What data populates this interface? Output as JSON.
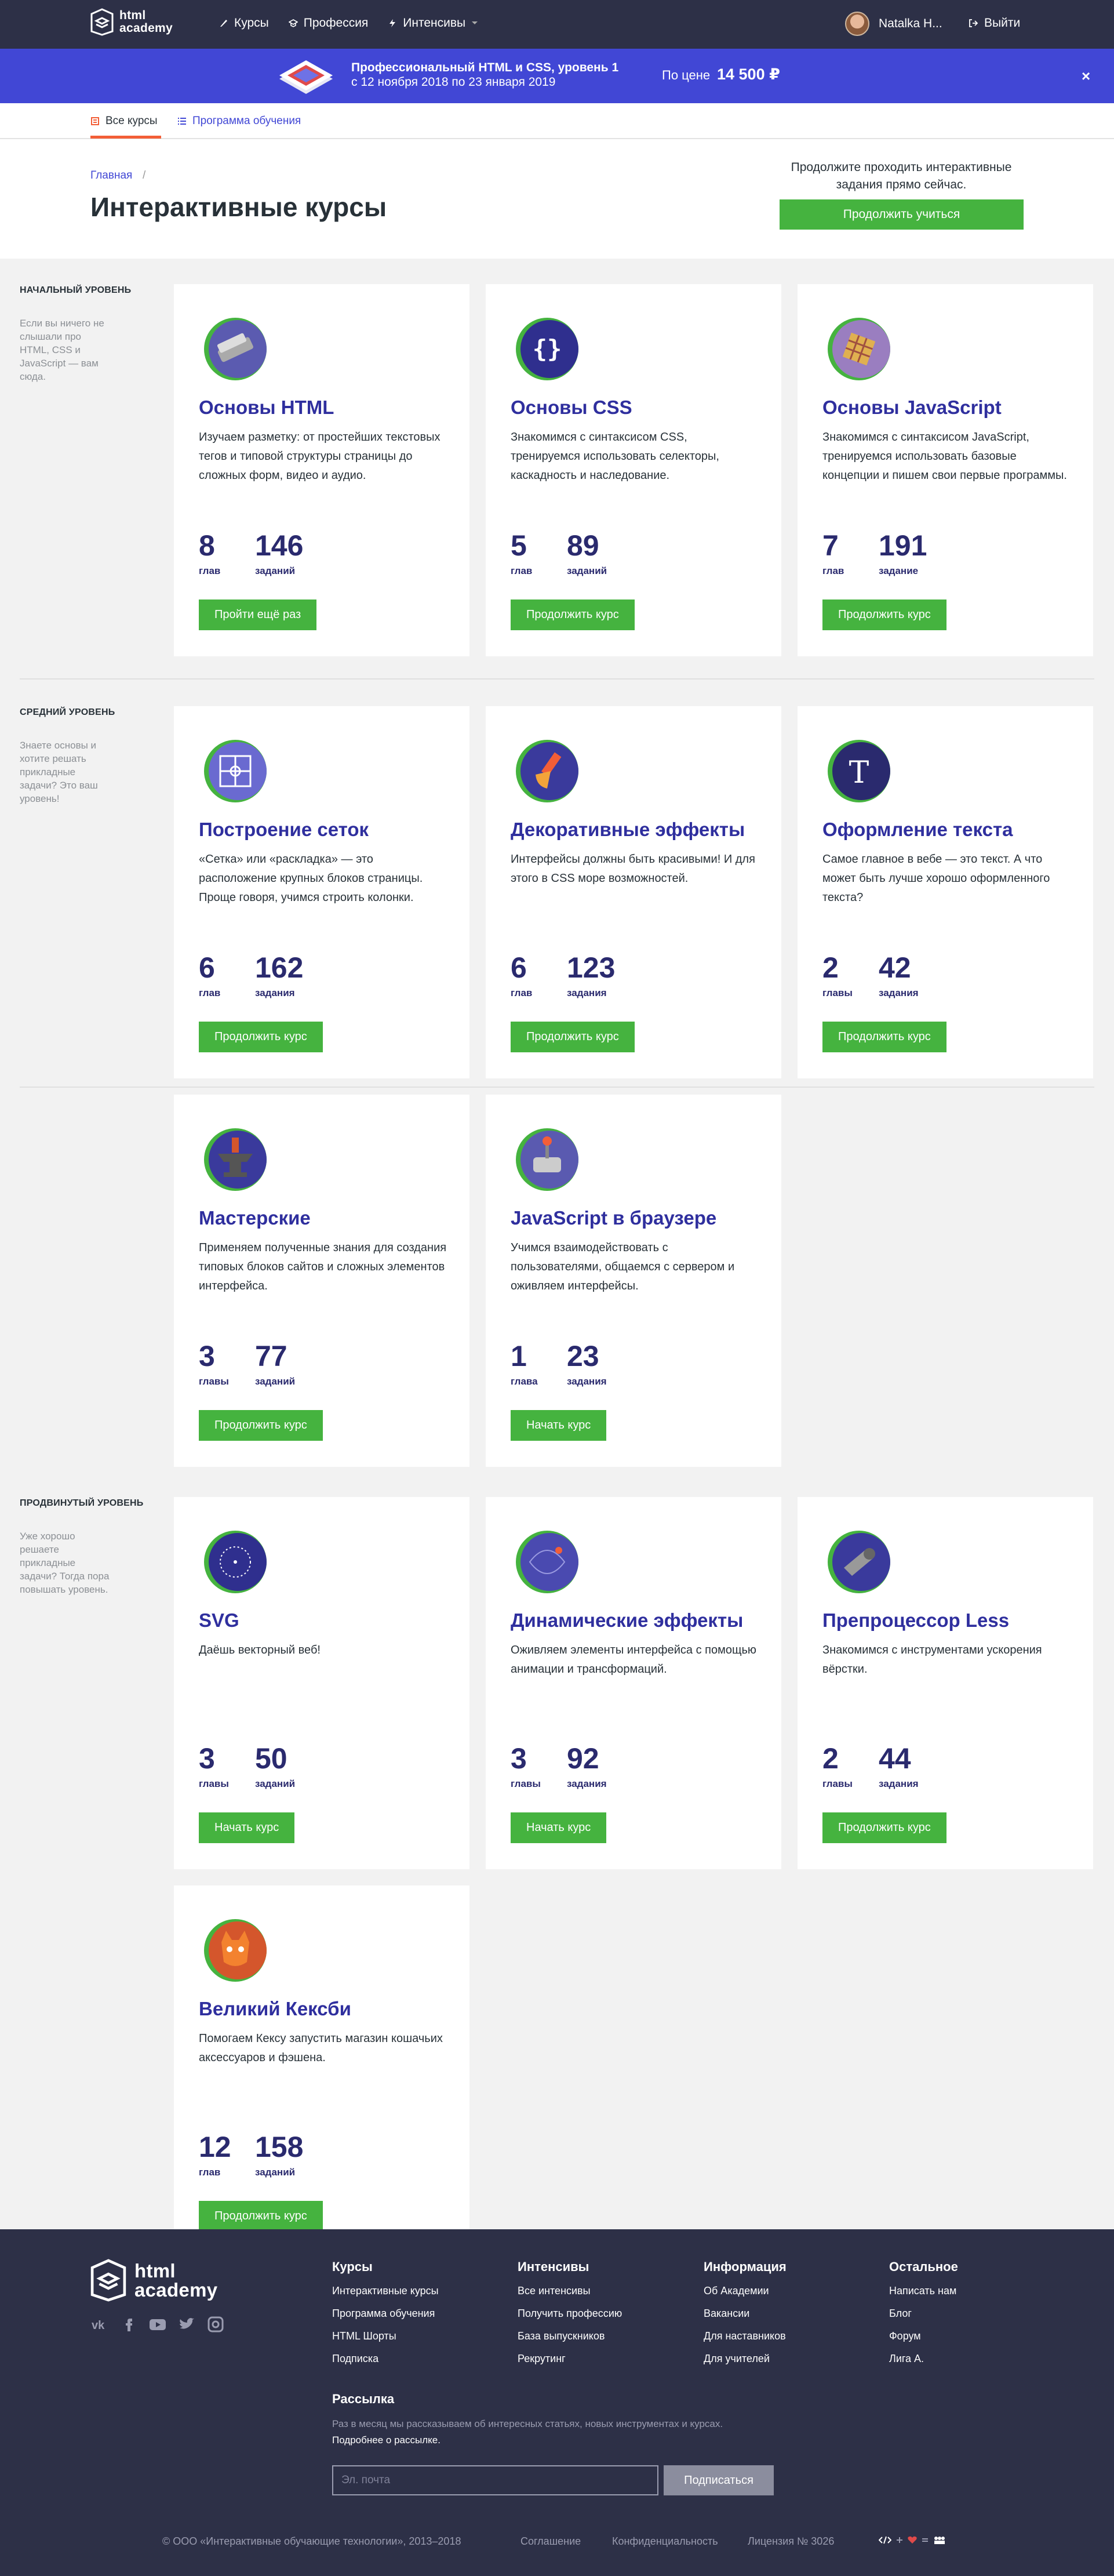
{
  "header": {
    "logo_text_1": "html",
    "logo_text_2": "academy",
    "nav": [
      {
        "label": "Курсы",
        "icon": "courses-icon"
      },
      {
        "label": "Профессия",
        "icon": "profession-icon"
      },
      {
        "label": "Интенсивы",
        "icon": "lightning-icon"
      }
    ],
    "user_name": "Natalka H...",
    "logout_label": "Выйти"
  },
  "promo": {
    "title": "Профессиональный HTML и CSS, уровень 1",
    "dates": "с 12 ноября 2018 по 23 января 2019",
    "price_label": "По цене",
    "price": "14 500 ₽",
    "close": "×"
  },
  "tabs": {
    "all_courses": "Все курсы",
    "program": "Программа обучения"
  },
  "page": {
    "breadcrumb": "Главная",
    "breadcrumb_sep": "/",
    "title": "Интерактивные курсы",
    "cta_text": "Продолжите проходить интерактивные задания прямо сейчас.",
    "cta_button": "Продолжить учиться"
  },
  "levels": [
    {
      "title": "НАЧАЛЬНЫЙ УРОВЕНЬ",
      "desc": "Если вы ничего не слышали про HTML, CSS и JavaScript — вам сюда.",
      "courses": [
        {
          "title": "Основы HTML",
          "desc": "Изучаем разметку: от простейших текстовых тегов и типовой структуры страницы до сложных форм, видео и аудио.",
          "n1": "8",
          "l1": "глав",
          "n2": "146",
          "l2": "заданий",
          "button": "Пройти ещё раз",
          "icon": "html-basics-icon"
        },
        {
          "title": "Основы CSS",
          "desc": "Знакомимся с синтаксисом CSS, тренируемся использовать селекторы, каскадность и наследование.",
          "n1": "5",
          "l1": "глав",
          "n2": "89",
          "l2": "заданий",
          "button": "Продолжить курс",
          "icon": "css-basics-icon"
        },
        {
          "title": "Основы JavaScript",
          "desc": "Знакомимся с синтаксисом JavaScript, тренируемся использовать базовые концепции и пишем свои первые программы.",
          "n1": "7",
          "l1": "глав",
          "n2": "191",
          "l2": "задание",
          "button": "Продолжить курс",
          "icon": "js-basics-icon"
        }
      ]
    },
    {
      "title": "СРЕДНИЙ УРОВЕНЬ",
      "desc": "Знаете основы и хотите решать прикладные задачи? Это ваш уровень!",
      "courses": [
        {
          "title": "Построение сеток",
          "desc": "«Сетка» или «раскладка» — это расположение крупных блоков страницы. Проще говоря, учимся строить колонки.",
          "n1": "6",
          "l1": "глав",
          "n2": "162",
          "l2": "задания",
          "button": "Продолжить курс",
          "icon": "grid-icon"
        },
        {
          "title": "Декоративные эффекты",
          "desc": "Интерфейсы должны быть красивыми! И для этого в CSS море возможностей.",
          "n1": "6",
          "l1": "глав",
          "n2": "123",
          "l2": "задания",
          "button": "Продолжить курс",
          "icon": "brush-icon"
        },
        {
          "title": "Оформление текста",
          "desc": "Самое главное в вебе — это текст. А что может быть лучше хорошо оформленного текста?",
          "n1": "2",
          "l1": "главы",
          "n2": "42",
          "l2": "задания",
          "button": "Продолжить курс",
          "icon": "typography-icon"
        },
        {
          "title": "Мастерские",
          "desc": "Применяем полученные знания для создания типовых блоков сайтов и сложных элементов интерфейса.",
          "n1": "3",
          "l1": "главы",
          "n2": "77",
          "l2": "заданий",
          "button": "Продолжить курс",
          "icon": "anvil-icon"
        },
        {
          "title": "JavaScript в браузере",
          "desc": "Учимся взаимодействовать с пользователями, общаемся с сервером и оживляем интерфейсы.",
          "n1": "1",
          "l1": "глава",
          "n2": "23",
          "l2": "задания",
          "button": "Начать курс",
          "icon": "joystick-icon"
        }
      ]
    },
    {
      "title": "ПРОДВИНУТЫЙ УРОВЕНЬ",
      "desc": "Уже хорошо решаете прикладные задачи? Тогда пора повышать уровень.",
      "courses": [
        {
          "title": "SVG",
          "desc": "Даёшь векторный веб!",
          "n1": "3",
          "l1": "главы",
          "n2": "50",
          "l2": "заданий",
          "button": "Начать курс",
          "icon": "svg-icon"
        },
        {
          "title": "Динамические эффекты",
          "desc": "Оживляем элементы интерфейса с помощью анимации и трансформаций.",
          "n1": "3",
          "l1": "главы",
          "n2": "92",
          "l2": "задания",
          "button": "Начать курс",
          "icon": "animation-icon"
        },
        {
          "title": "Препроцессор Less",
          "desc": "Знакомимся с инструментами ускорения вёрстки.",
          "n1": "2",
          "l1": "главы",
          "n2": "44",
          "l2": "задания",
          "button": "Продолжить курс",
          "icon": "less-icon"
        },
        {
          "title": "Великий Кексби",
          "desc": "Помогаем Кексу запустить магазин кошачьих аксессуаров и фэшена.",
          "n1": "12",
          "l1": "глав",
          "n2": "158",
          "l2": "заданий",
          "button": "Продолжить курс",
          "icon": "cat-icon"
        }
      ]
    }
  ],
  "footer": {
    "cols": [
      {
        "title": "Курсы",
        "links": [
          "Интерактивные курсы",
          "Программа обучения",
          "HTML Шорты",
          "Подписка"
        ]
      },
      {
        "title": "Интенсивы",
        "links": [
          "Все интенсивы",
          "Получить профессию",
          "База выпускников",
          "Рекрутинг"
        ]
      },
      {
        "title": "Информация",
        "links": [
          "Об Академии",
          "Вакансии",
          "Для наставников",
          "Для учителей"
        ]
      },
      {
        "title": "Остальное",
        "links": [
          "Написать нам",
          "Блог",
          "Форум",
          "Лига А."
        ]
      }
    ],
    "newsletter_title": "Рассылка",
    "newsletter_text": "Раз в месяц мы рассказываем об интересных статьях, новых инструментах и курсах.",
    "newsletter_more": "Подробнее о рассылке.",
    "email_placeholder": "Эл. почта",
    "subscribe": "Подписаться",
    "copyright": "© ООО «Интерактивные обучающие технологии», 2013–2018",
    "agreement": "Соглашение",
    "privacy": "Конфиденциальность",
    "license": "Лицензия № 3026"
  },
  "colors": {
    "accent": "#4147d5",
    "button": "#45b33f",
    "dark": "#2d3047",
    "title": "#2f2f9e"
  }
}
